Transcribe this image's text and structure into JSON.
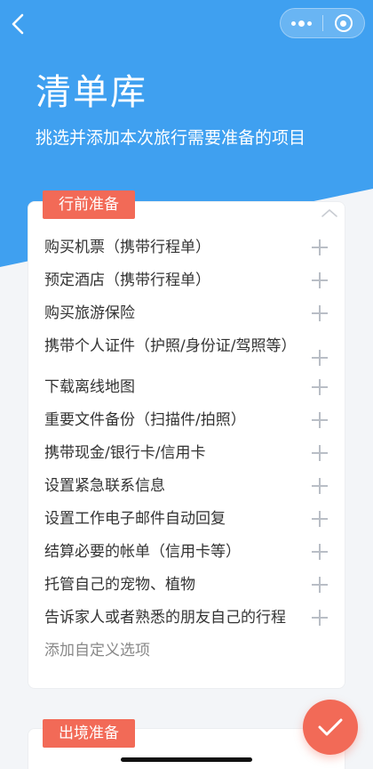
{
  "header": {
    "title": "清单库",
    "subtitle": "挑选并添加本次旅行需要准备的项目",
    "color": "#3fa0f0"
  },
  "nav": {
    "back_icon": "chevron-left-icon",
    "more_icon": "more-dots-icon",
    "close_icon": "target-circle-icon"
  },
  "section_pre": {
    "tag": "行前准备",
    "tag_color": "#f26a57",
    "items": [
      "购买机票（携带行程单）",
      "预定酒店（携带行程单）",
      "购买旅游保险",
      "携带个人证件（护照/身份证/驾照等）",
      "下载离线地图",
      "重要文件备份（扫描件/拍照）",
      "携带现金/银行卡/信用卡",
      "设置紧急联系信息",
      "设置工作电子邮件自动回复",
      "结算必要的帐单（信用卡等）",
      "托管自己的宠物、植物",
      "告诉家人或者熟悉的朋友自己的行程"
    ],
    "custom_option": "添加自定义选项"
  },
  "section_exit": {
    "tag": "出境准备"
  },
  "fab_icon": "checkmark-icon"
}
